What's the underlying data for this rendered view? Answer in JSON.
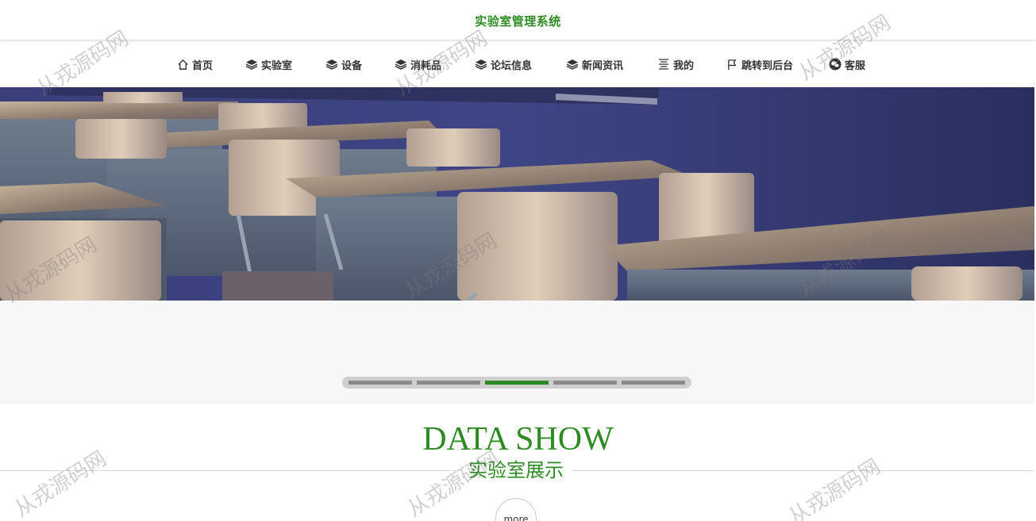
{
  "site": {
    "title": "实验室管理系统"
  },
  "nav": {
    "items": [
      {
        "label": "首页",
        "icon": "home-icon"
      },
      {
        "label": "实验室",
        "icon": "layers-icon"
      },
      {
        "label": "设备",
        "icon": "layers-icon"
      },
      {
        "label": "消耗品",
        "icon": "layers-icon"
      },
      {
        "label": "论坛信息",
        "icon": "layers-icon"
      },
      {
        "label": "新闻资讯",
        "icon": "layers-icon"
      },
      {
        "label": "我的",
        "icon": "menu-lines-icon"
      },
      {
        "label": "跳转到后台",
        "icon": "flag-icon"
      },
      {
        "label": "客服",
        "icon": "wechat-icon"
      }
    ]
  },
  "carousel": {
    "slide_count": 5,
    "active_index": 2
  },
  "section": {
    "heading": "DATA SHOW",
    "subheading": "实验室展示",
    "more_label": "more"
  },
  "watermark": {
    "text": "从戎源码网"
  },
  "colors": {
    "accent": "#2e8b23",
    "nav_text": "#333333",
    "slider_bg": "#f7f7f7",
    "pager_track": "#cfcfcf",
    "pager_inactive": "#8a8a8a"
  }
}
